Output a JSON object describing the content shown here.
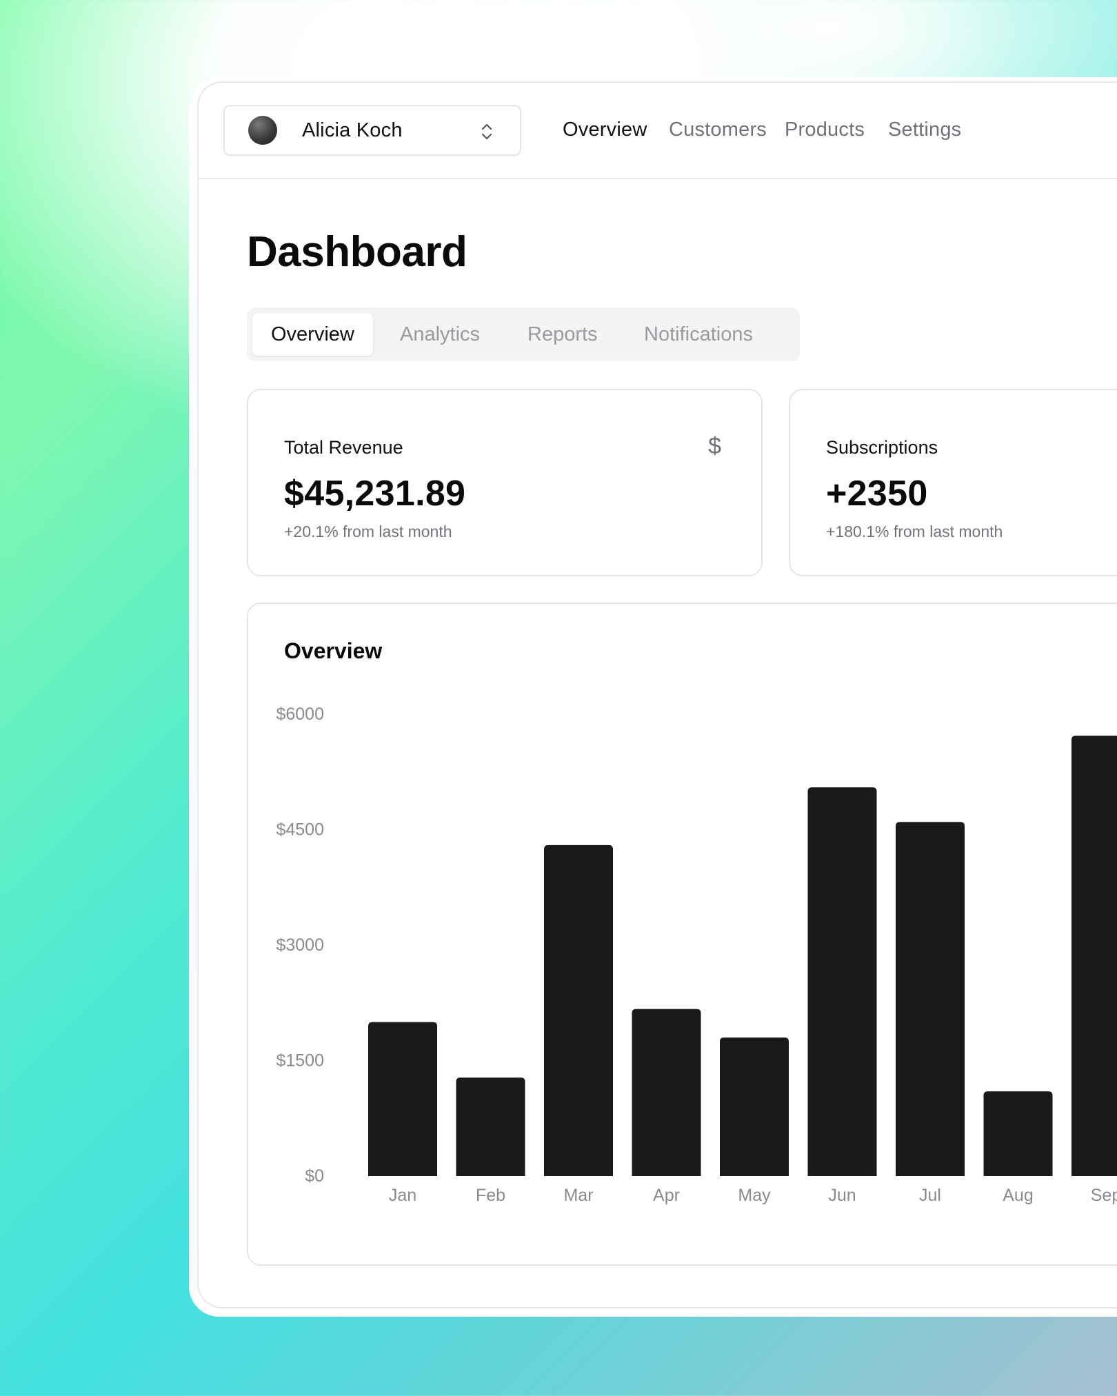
{
  "account": {
    "name": "Alicia Koch"
  },
  "nav": {
    "items": [
      {
        "label": "Overview",
        "active": true
      },
      {
        "label": "Customers",
        "active": false
      },
      {
        "label": "Products",
        "active": false
      },
      {
        "label": "Settings",
        "active": false
      }
    ]
  },
  "page": {
    "title": "Dashboard"
  },
  "tabs": [
    {
      "label": "Overview",
      "active": true
    },
    {
      "label": "Analytics",
      "active": false
    },
    {
      "label": "Reports",
      "active": false
    },
    {
      "label": "Notifications",
      "active": false
    }
  ],
  "stats": [
    {
      "label": "Total Revenue",
      "icon": "dollar-icon",
      "icon_glyph": "$",
      "value": "$45,231.89",
      "sub": "+20.1% from last month"
    },
    {
      "label": "Subscriptions",
      "value": "+2350",
      "sub": "+180.1% from last month"
    }
  ],
  "overview": {
    "title": "Overview"
  },
  "chart_data": {
    "type": "bar",
    "title": "Overview",
    "categories": [
      "Jan",
      "Feb",
      "Mar",
      "Apr",
      "May",
      "Jun",
      "Jul",
      "Aug",
      "Sep"
    ],
    "values": [
      2000,
      1280,
      4300,
      2170,
      1800,
      5050,
      4600,
      1100,
      5720
    ],
    "ylim": [
      0,
      6000
    ],
    "yticks": [
      0,
      1500,
      3000,
      4500,
      6000
    ],
    "ytick_labels": [
      "$0",
      "$1500",
      "$3000",
      "$4500",
      "$6000"
    ],
    "xlabel": "",
    "ylabel": "",
    "grid": false,
    "bar_color": "#19191b",
    "tick_color": "#8a8a90"
  },
  "colors": {
    "accent": "#0a0a0a",
    "muted_text": "#71717a",
    "border": "#e6e6e9"
  }
}
